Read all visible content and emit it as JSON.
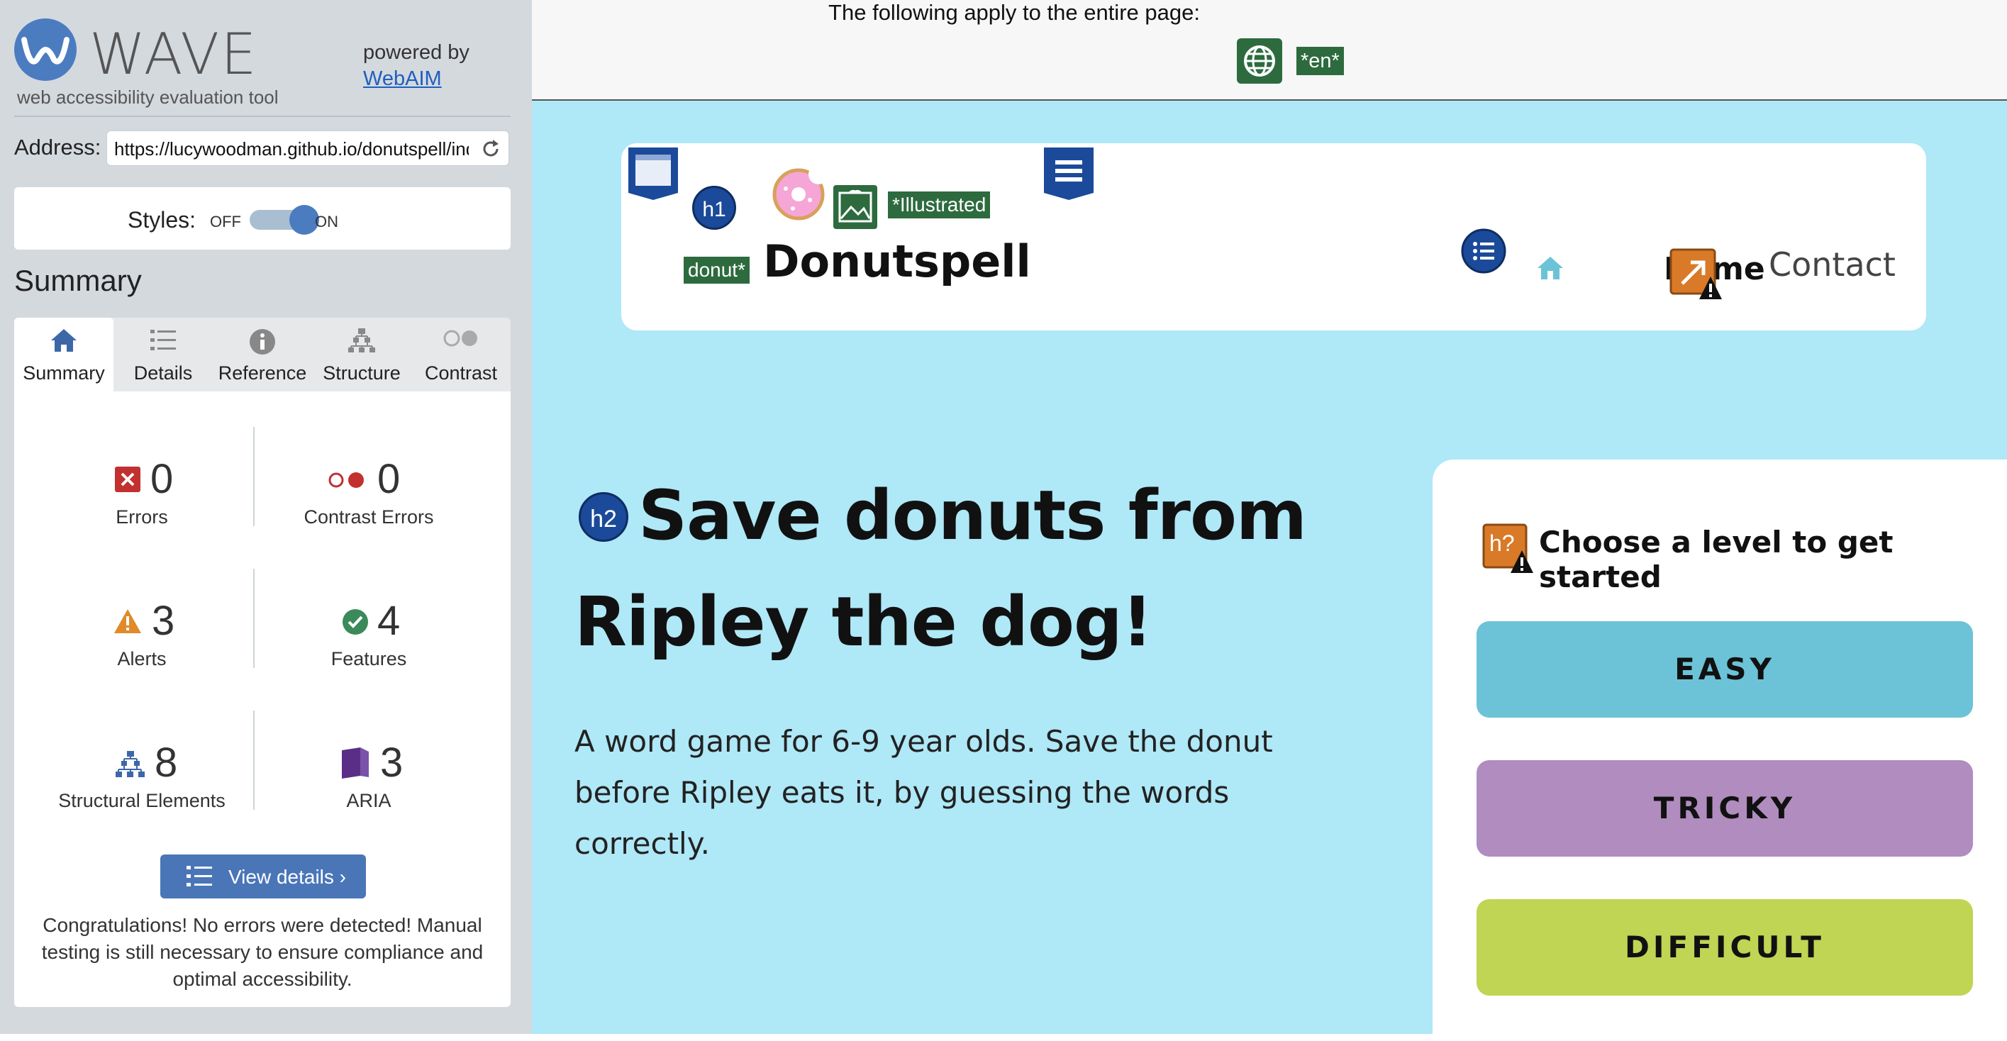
{
  "wave": {
    "title": "WAVE",
    "subtitle": "web accessibility evaluation tool",
    "powered_by": "powered by",
    "webaim_link": "WebAIM",
    "address_label": "Address:",
    "address_value": "https://lucywoodman.github.io/donutspell/index.html",
    "styles_label": "Styles:",
    "styles_off": "OFF",
    "styles_on": "ON",
    "summary_heading": "Summary",
    "tabs": [
      {
        "label": "Summary",
        "icon": "home-icon",
        "active": true
      },
      {
        "label": "Details",
        "icon": "list-icon",
        "active": false
      },
      {
        "label": "Reference",
        "icon": "info-icon",
        "active": false
      },
      {
        "label": "Structure",
        "icon": "structure-icon",
        "active": false
      },
      {
        "label": "Contrast",
        "icon": "contrast-icon",
        "active": false
      }
    ],
    "stats": {
      "errors": {
        "count": "0",
        "label": "Errors"
      },
      "contrast_errors": {
        "count": "0",
        "label": "Contrast Errors"
      },
      "alerts": {
        "count": "3",
        "label": "Alerts"
      },
      "features": {
        "count": "4",
        "label": "Features"
      },
      "structural": {
        "count": "8",
        "label": "Structural Elements"
      },
      "aria": {
        "count": "3",
        "label": "ARIA"
      }
    },
    "view_details": "View details ›",
    "congrats": "Congratulations! No errors were detected! Manual testing is still necessary to ensure compliance and optimal accessibility."
  },
  "page": {
    "banner_text": "The following apply to the entire page:",
    "lang_tag": "*en*",
    "header": {
      "site_title": "Donutspell",
      "h1_badge": "h1",
      "illustrated_tag": "*Illustrated",
      "donut_tag": "donut*",
      "nav_home": "Home",
      "nav_contact": "Contact"
    },
    "hero": {
      "h2_badge": "h2",
      "title": "Save donuts from Ripley the dog!",
      "text": "A word game for 6-9 year olds. Save the donut before Ripley eats it, by guessing the words correctly."
    },
    "levels": {
      "heading_badge": "h?",
      "heading": "Choose a level to get started",
      "buttons": [
        {
          "label": "EASY",
          "color": "#6cc3d8"
        },
        {
          "label": "TRICKY",
          "color": "#b08cbf"
        },
        {
          "label": "DIFFICULT",
          "color": "#c0d554"
        }
      ]
    }
  },
  "colors": {
    "wave_bg": "#d4d9de",
    "wave_blue": "#4a76b8",
    "page_bg": "#afe8f7",
    "feature_green": "#2d6b3f",
    "aria_navy": "#1b4a9a",
    "alert_orange": "#d97a28"
  }
}
